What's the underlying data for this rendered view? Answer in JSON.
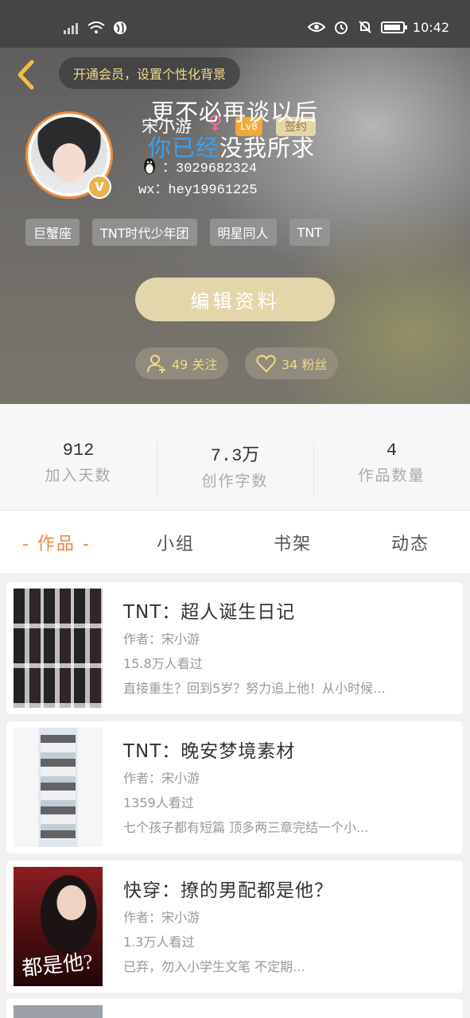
{
  "status_bar": {
    "time": "10:42"
  },
  "header": {
    "vip_prompt": "开通会员，设置个性化背景",
    "overlay_line1": "更不必再谈以后",
    "overlay_line2_blue": "你已经",
    "overlay_line2_white": "没我所求",
    "username": "宋小游",
    "gender_symbol": "♀",
    "level": "Lv8",
    "sign_label": "签约",
    "qq": "：3029682324",
    "wx": "wx：hey19961225",
    "avatar_badge": "V",
    "tags": [
      "巨蟹座",
      "TNT时代少年团",
      "明星同人",
      "TNT"
    ],
    "edit_button": "编辑资料",
    "following": "49 关注",
    "followers": "34 粉丝"
  },
  "stats": [
    {
      "value": "912",
      "label": "加入天数"
    },
    {
      "value": "7.3万",
      "label": "创作字数"
    },
    {
      "value": "4",
      "label": "作品数量"
    }
  ],
  "tabs": [
    "- 作品 -",
    "小组",
    "书架",
    "动态"
  ],
  "works": [
    {
      "title": "TNT：超人诞生日记",
      "author": "作者：宋小游",
      "views": "15.8万人看过",
      "desc": "直接重生？回到5岁？努力追上他！从小时候..."
    },
    {
      "title": "TNT：晚安梦境素材",
      "author": "作者：宋小游",
      "views": "1359人看过",
      "desc": "七个孩子都有短篇 顶多两三章完结一个小..."
    },
    {
      "title": "快穿：撩的男配都是他？",
      "author": "作者：宋小游",
      "views": "1.3万人看过",
      "desc": "已弃，勿入小学生文笔 不定期...",
      "cover_text": "都是他?"
    }
  ],
  "colors": {
    "accent": "#f0884a",
    "gold": "#e4d6ab",
    "vip_text": "#f0d98a"
  }
}
